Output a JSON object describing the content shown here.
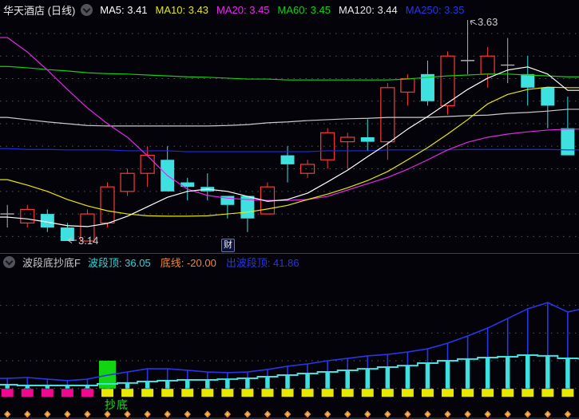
{
  "header": {
    "title": "华天酒店 (日线)",
    "ma_legend": [
      {
        "label": "MA5:",
        "value": "3.41",
        "color": "#ffffff"
      },
      {
        "label": "MA10:",
        "value": "3.43",
        "color": "#e8e800"
      },
      {
        "label": "MA20:",
        "value": "3.45",
        "color": "#ee28ee"
      },
      {
        "label": "MA60:",
        "value": "3.45",
        "color": "#12d412"
      },
      {
        "label": "MA120:",
        "value": "3.44",
        "color": "#e9e9e9"
      },
      {
        "label": "MA250:",
        "value": "3.35",
        "color": "#2a35e8"
      }
    ]
  },
  "indicator_header": {
    "name": "波段底抄底F",
    "fields": [
      {
        "label": "波段顶:",
        "value": "36.05",
        "color": "#2bd8d8"
      },
      {
        "label": "底线:",
        "value": "-20.00",
        "color": "#f08a2a"
      },
      {
        "label": "出波段顶:",
        "value": "41.86",
        "color": "#2a35e8"
      }
    ]
  },
  "annotations": {
    "high": "3.63",
    "low": "3.14",
    "buy_signal": "抄底",
    "event_marker": "财"
  },
  "chart_data": [
    {
      "type": "candlestick",
      "title": "华天酒店 日线",
      "bars": 29,
      "price_labels": {
        "high": 3.63,
        "low": 3.14
      },
      "grid": {
        "price_min": 3.15,
        "price_max": 3.6,
        "step": 0.05
      },
      "candle_colors": {
        "up": "#ff3838",
        "down": "#3fe0e0",
        "doji": "#b0b0b0"
      },
      "candles": [
        {
          "o": 3.2,
          "h": 3.22,
          "l": 3.17,
          "c": 3.2,
          "t": "j"
        },
        {
          "o": 3.18,
          "h": 3.22,
          "l": 3.17,
          "c": 3.21,
          "t": "u"
        },
        {
          "o": 3.2,
          "h": 3.21,
          "l": 3.16,
          "c": 3.17,
          "t": "d"
        },
        {
          "o": 3.17,
          "h": 3.18,
          "l": 3.14,
          "c": 3.14,
          "t": "d"
        },
        {
          "o": 3.14,
          "h": 3.21,
          "l": 3.14,
          "c": 3.2,
          "t": "u"
        },
        {
          "o": 3.18,
          "h": 3.27,
          "l": 3.17,
          "c": 3.26,
          "t": "u"
        },
        {
          "o": 3.25,
          "h": 3.3,
          "l": 3.24,
          "c": 3.29,
          "t": "u"
        },
        {
          "o": 3.29,
          "h": 3.35,
          "l": 3.26,
          "c": 3.33,
          "t": "u"
        },
        {
          "o": 3.32,
          "h": 3.35,
          "l": 3.25,
          "c": 3.25,
          "t": "d"
        },
        {
          "o": 3.27,
          "h": 3.28,
          "l": 3.23,
          "c": 3.26,
          "t": "d"
        },
        {
          "o": 3.26,
          "h": 3.29,
          "l": 3.23,
          "c": 3.25,
          "t": "d"
        },
        {
          "o": 3.24,
          "h": 3.24,
          "l": 3.19,
          "c": 3.22,
          "t": "d"
        },
        {
          "o": 3.24,
          "h": 3.24,
          "l": 3.16,
          "c": 3.19,
          "t": "d"
        },
        {
          "o": 3.2,
          "h": 3.27,
          "l": 3.2,
          "c": 3.26,
          "t": "u"
        },
        {
          "o": 3.33,
          "h": 3.35,
          "l": 3.27,
          "c": 3.31,
          "t": "d"
        },
        {
          "o": 3.29,
          "h": 3.32,
          "l": 3.28,
          "c": 3.31,
          "t": "u"
        },
        {
          "o": 3.32,
          "h": 3.39,
          "l": 3.3,
          "c": 3.38,
          "t": "u"
        },
        {
          "o": 3.36,
          "h": 3.38,
          "l": 3.3,
          "c": 3.37,
          "t": "u"
        },
        {
          "o": 3.37,
          "h": 3.41,
          "l": 3.34,
          "c": 3.36,
          "t": "d"
        },
        {
          "o": 3.36,
          "h": 3.49,
          "l": 3.32,
          "c": 3.48,
          "t": "u"
        },
        {
          "o": 3.47,
          "h": 3.51,
          "l": 3.44,
          "c": 3.5,
          "t": "u"
        },
        {
          "o": 3.51,
          "h": 3.54,
          "l": 3.44,
          "c": 3.45,
          "t": "d"
        },
        {
          "o": 3.44,
          "h": 3.56,
          "l": 3.42,
          "c": 3.55,
          "t": "u"
        },
        {
          "o": 3.54,
          "h": 3.63,
          "l": 3.51,
          "c": 3.54,
          "t": "j"
        },
        {
          "o": 3.51,
          "h": 3.57,
          "l": 3.48,
          "c": 3.55,
          "t": "u"
        },
        {
          "o": 3.53,
          "h": 3.59,
          "l": 3.49,
          "c": 3.53,
          "t": "j"
        },
        {
          "o": 3.51,
          "h": 3.55,
          "l": 3.44,
          "c": 3.48,
          "t": "d"
        },
        {
          "o": 3.48,
          "h": 3.48,
          "l": 3.39,
          "c": 3.44,
          "t": "d"
        },
        {
          "o": 3.39,
          "h": 3.46,
          "l": 3.33,
          "c": 3.33,
          "t": "d"
        }
      ],
      "ma": [
        {
          "name": "MA250",
          "color": "#1f2ae0",
          "values": [
            3.345,
            3.343,
            3.343,
            3.342,
            3.342,
            3.342,
            3.34,
            3.34,
            3.34,
            3.338,
            3.338,
            3.338,
            3.338,
            3.338,
            3.338,
            3.338,
            3.34,
            3.34,
            3.34,
            3.342,
            3.342,
            3.342,
            3.342,
            3.343,
            3.343,
            3.343,
            3.343,
            3.343,
            3.342
          ]
        },
        {
          "name": "MA120",
          "color": "#c9c9c9",
          "values": [
            3.414,
            3.409,
            3.404,
            3.4,
            3.396,
            3.395,
            3.395,
            3.395,
            3.395,
            3.395,
            3.395,
            3.396,
            3.398,
            3.402,
            3.404,
            3.407,
            3.409,
            3.411,
            3.412,
            3.414,
            3.414,
            3.414,
            3.416,
            3.418,
            3.419,
            3.423,
            3.425,
            3.428,
            3.432
          ]
        },
        {
          "name": "MA60",
          "color": "#12cf12",
          "values": [
            3.527,
            3.524,
            3.52,
            3.517,
            3.513,
            3.511,
            3.51,
            3.508,
            3.506,
            3.504,
            3.503,
            3.501,
            3.499,
            3.499,
            3.497,
            3.497,
            3.497,
            3.497,
            3.497,
            3.497,
            3.499,
            3.503,
            3.506,
            3.508,
            3.51,
            3.51,
            3.508,
            3.506,
            3.504
          ]
        },
        {
          "name": "MA20",
          "color": "#e628e6",
          "values": [
            3.591,
            3.559,
            3.519,
            3.476,
            3.435,
            3.4,
            3.37,
            3.329,
            3.285,
            3.255,
            3.241,
            3.235,
            3.232,
            3.23,
            3.23,
            3.232,
            3.239,
            3.253,
            3.267,
            3.281,
            3.299,
            3.32,
            3.342,
            3.359,
            3.37,
            3.377,
            3.382,
            3.386,
            3.388
          ]
        },
        {
          "name": "MA10",
          "color": "#e8e800",
          "values": [
            3.276,
            3.264,
            3.25,
            3.232,
            3.218,
            3.207,
            3.2,
            3.196,
            3.195,
            3.195,
            3.196,
            3.2,
            3.204,
            3.211,
            3.219,
            3.232,
            3.244,
            3.258,
            3.274,
            3.294,
            3.32,
            3.347,
            3.377,
            3.409,
            3.444,
            3.465,
            3.476,
            3.481,
            3.48
          ]
        },
        {
          "name": "MA5",
          "color": "#ffffff",
          "values": [
            3.193,
            3.189,
            3.182,
            3.174,
            3.172,
            3.179,
            3.195,
            3.216,
            3.237,
            3.25,
            3.255,
            3.25,
            3.239,
            3.228,
            3.232,
            3.246,
            3.271,
            3.297,
            3.327,
            3.356,
            3.388,
            3.416,
            3.446,
            3.476,
            3.501,
            3.519,
            3.526,
            3.51,
            3.474
          ]
        }
      ]
    },
    {
      "type": "indicator",
      "name": "波段底抄底F",
      "grid_values": [
        40,
        20,
        0,
        -20
      ],
      "baseline": -20,
      "series": [
        {
          "name": "波段顶",
          "color": "#3fe0e0",
          "style": "step-bars",
          "edge_right": 1.2,
          "values": [
            -17.3,
            -17.9,
            -17.9,
            -17.9,
            -17.9,
            -16.7,
            -16.1,
            -15.0,
            -14.4,
            -13.8,
            -13.8,
            -13.3,
            -12.7,
            -11.5,
            -10.4,
            -9.2,
            -8.1,
            -6.9,
            -5.8,
            -4.6,
            -3.5,
            -1.7,
            0.0,
            1.2,
            2.3,
            2.9,
            4.0,
            3.5,
            1.7
          ]
        },
        {
          "name": "出波段顶",
          "color": "#2a35e8",
          "style": "line",
          "edge_right": 37.0,
          "values": [
            -12.7,
            -12.1,
            -13.3,
            -14.4,
            -13.3,
            -10.4,
            -8.1,
            -5.8,
            -5.8,
            -6.9,
            -8.1,
            -8.6,
            -8.1,
            -6.3,
            -4.0,
            -2.3,
            0.0,
            1.7,
            3.5,
            4.6,
            6.3,
            8.6,
            12.7,
            17.9,
            23.6,
            30.5,
            37.5,
            42.0,
            35.2
          ]
        }
      ],
      "blocks": [
        "m",
        "m",
        "m",
        "m",
        "m",
        "y",
        "y",
        "y",
        "y",
        "y",
        "y",
        "y",
        "y",
        "y",
        "y",
        "y",
        "y",
        "y",
        "y",
        "y",
        "y",
        "y",
        "y",
        "y",
        "y",
        "y",
        "y",
        "y",
        "y"
      ],
      "block_colors": {
        "m": "#ee0990",
        "y": "#e8e800"
      },
      "green_block": {
        "bar": 5,
        "top_value": 0,
        "color": "#12d412"
      },
      "diamonds": "all-bars",
      "diamond_color": "#e89030"
    }
  ]
}
